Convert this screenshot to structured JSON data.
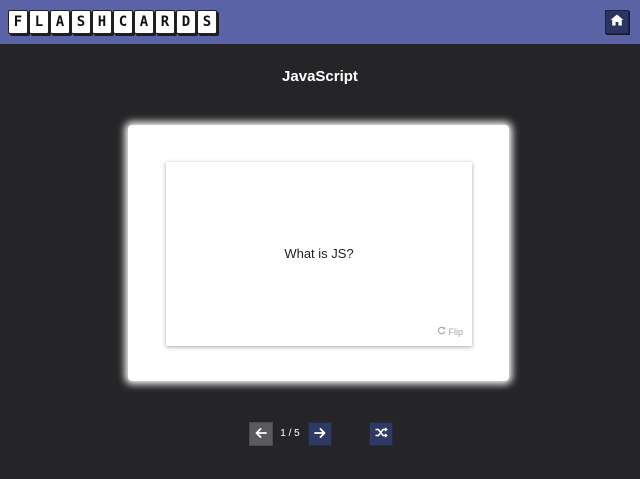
{
  "header": {
    "logo_letters": [
      "F",
      "L",
      "A",
      "S",
      "H",
      "C",
      "A",
      "R",
      "D",
      "S"
    ],
    "home_icon": "home-icon",
    "accent": "#5a63a6"
  },
  "deck": {
    "title": "JavaScript"
  },
  "card": {
    "question": "What is JS?",
    "flip_label": "Flip",
    "flip_icon": "refresh-icon"
  },
  "pager": {
    "current": 1,
    "total": 5,
    "label": "1 / 5",
    "prev_icon": "arrow-left-icon",
    "next_icon": "arrow-right-icon",
    "shuffle_icon": "shuffle-icon"
  },
  "colors": {
    "background": "#252527",
    "nav_button": "#2f3a63",
    "nav_button_disabled": "#5b5b5e"
  }
}
